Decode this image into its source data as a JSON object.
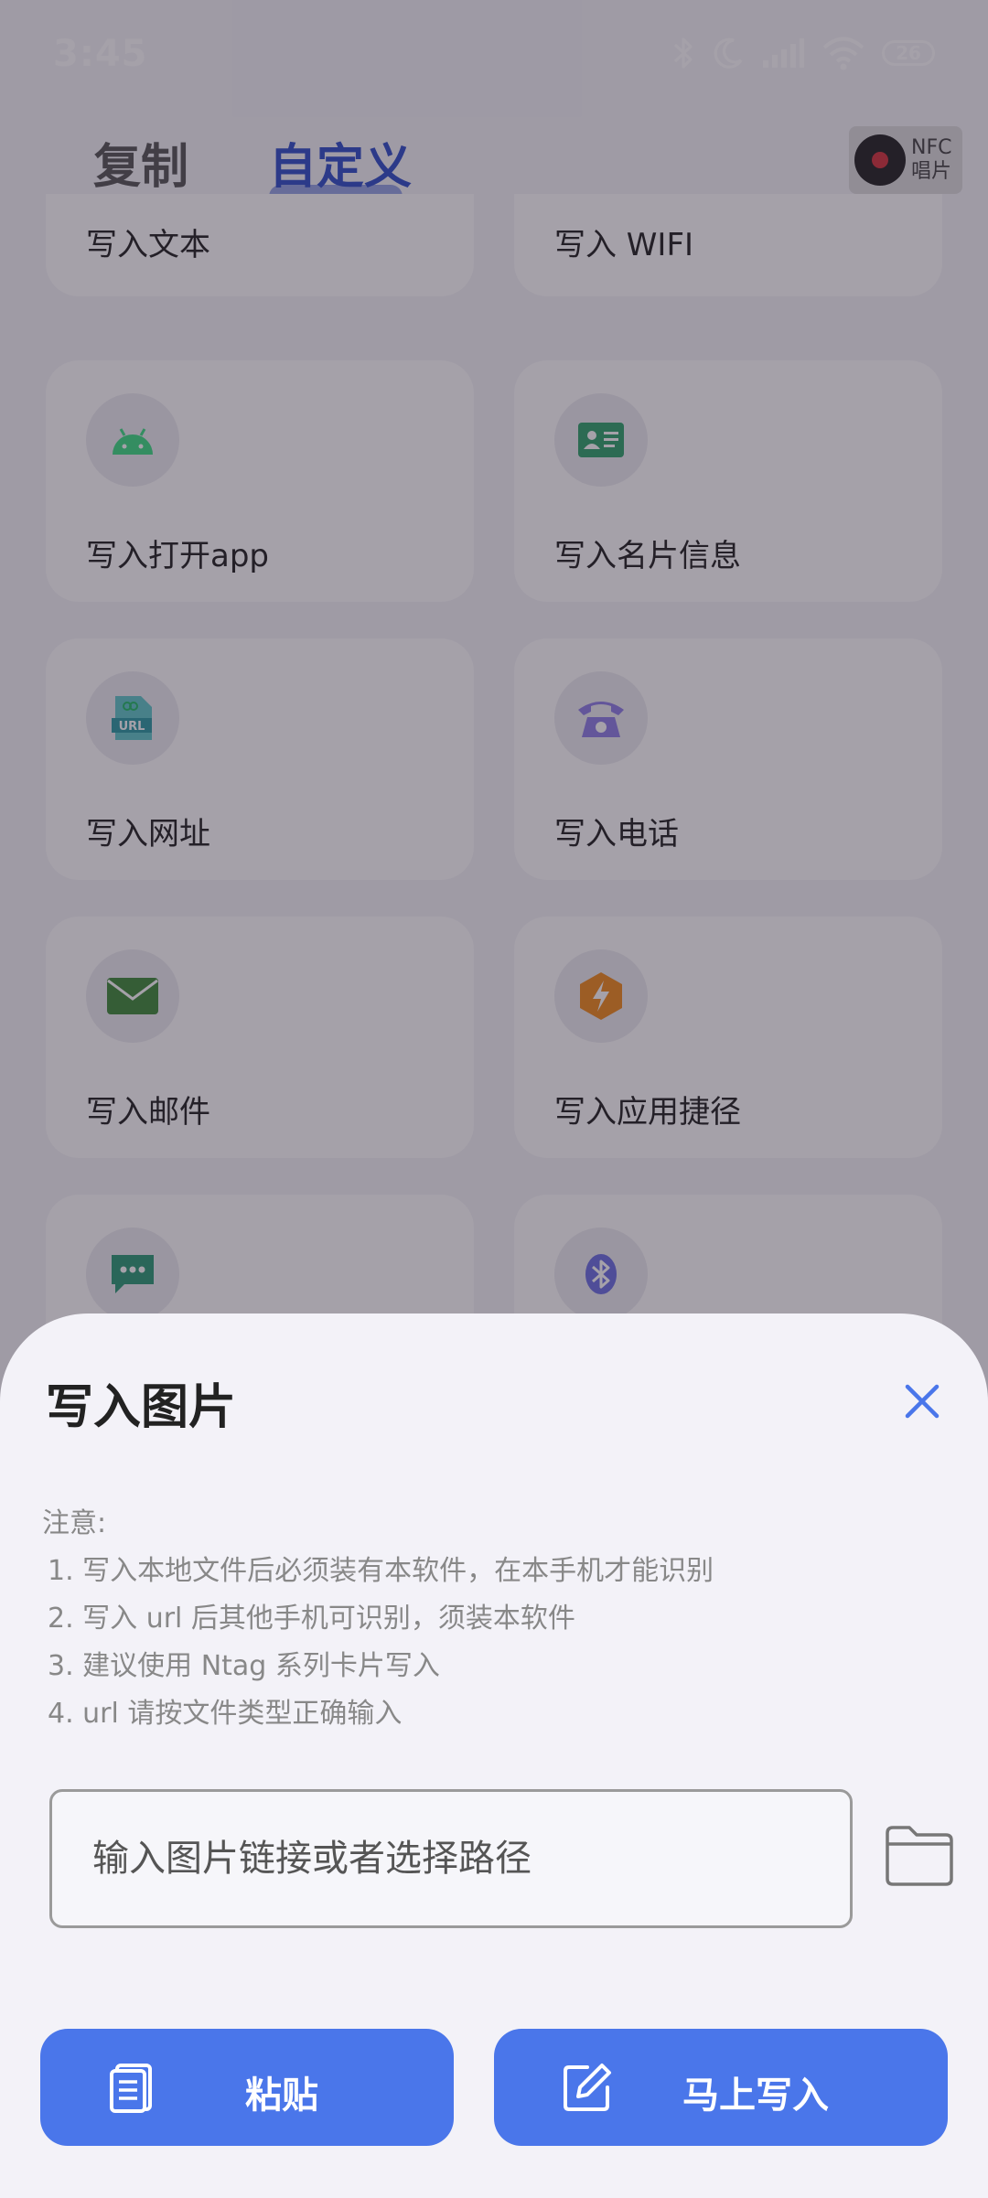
{
  "status_bar": {
    "time": "3:45",
    "battery": "26",
    "icons": [
      "bluetooth-icon",
      "moon-icon",
      "signal-icon",
      "wifi-icon",
      "battery-icon"
    ]
  },
  "tabs": [
    {
      "label": "复制"
    },
    {
      "label": "自定义",
      "active": true
    }
  ],
  "logo": {
    "line1": "NFC",
    "line2": "唱片"
  },
  "cards": [
    {
      "label": "写入文本"
    },
    {
      "label": "写入 WIFI"
    },
    {
      "label": "写入打开app",
      "icon": "android-icon"
    },
    {
      "label": "写入名片信息",
      "icon": "contact-card-icon"
    },
    {
      "label": "写入网址",
      "icon": "url-file-icon"
    },
    {
      "label": "写入电话",
      "icon": "telephone-icon"
    },
    {
      "label": "写入邮件",
      "icon": "mail-icon"
    },
    {
      "label": "写入应用捷径",
      "icon": "shortcut-bolt-icon"
    },
    {
      "label": "",
      "icon": "sms-icon"
    },
    {
      "label": "",
      "icon": "bluetooth-icon"
    }
  ],
  "sheet": {
    "title": "写入图片",
    "notes_heading": "注意:",
    "notes": [
      "1. 写入本地文件后必须装有本软件，在本手机才能识别",
      "2. 写入 url 后其他手机可识别，须装本软件",
      "3. 建议使用 Ntag 系列卡片写入",
      "4. url 请按文件类型正确输入"
    ],
    "input_placeholder": "输入图片链接或者选择路径",
    "paste_label": "粘贴",
    "write_label": "马上写入"
  },
  "colors": {
    "accent": "#4a76ea",
    "tab_active": "#2f4ec8"
  }
}
